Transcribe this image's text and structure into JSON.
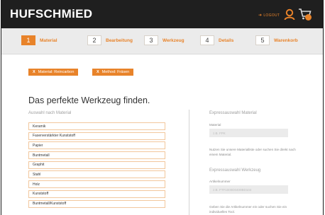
{
  "header": {
    "logo": "HUFSCHMiED",
    "logout": "LOGOUT"
  },
  "steps": [
    {
      "num": "1",
      "label": "Material"
    },
    {
      "num": "2",
      "label": "Bearbeitung"
    },
    {
      "num": "3",
      "label": "Werkzeug"
    },
    {
      "num": "4",
      "label": "Details"
    },
    {
      "num": "5",
      "label": "Warenkorb"
    }
  ],
  "filters": [
    {
      "x": "X",
      "label": "Material: Reincarbon"
    },
    {
      "x": "X",
      "label": "Method: Fräsen"
    }
  ],
  "main": {
    "heading": "Das perfekte Werkzeug finden.",
    "material_section": "Auswahl nach Material",
    "materials": [
      "Keramik",
      "Faserverstärkter Kunststoff",
      "Papier",
      "Buntmetall",
      "Graphit",
      "Stahl",
      "Holz",
      "Kunststoff",
      "Buntmetall/Kunststoff"
    ]
  },
  "express": {
    "material_heading": "Expressauswahl Material",
    "material_label": "Material",
    "material_placeholder": "z.B. FPK",
    "material_hint": "Nutzen Sie unsere Materialliste oder suchen Sie direkt nach einem Material.",
    "tool_heading": "Expressauswahl Werkzeug",
    "tool_label": "Artikelnummer",
    "tool_placeholder": "z.B. FTF1000D0400BD104",
    "tool_hint": "Geben Sie die Artikelnummer ein oder suchen Sie ein individuelles Tool."
  },
  "colors": {
    "accent": "#e8832a",
    "header_bg": "#1f1f1f",
    "steps_bg": "#ebebeb"
  },
  "icons": [
    "logout-arrow-icon",
    "user-icon",
    "cart-icon"
  ]
}
